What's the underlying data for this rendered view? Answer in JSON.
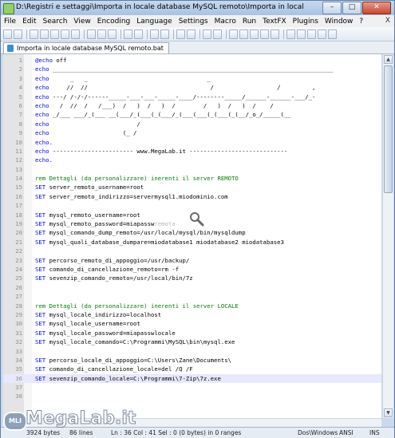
{
  "window": {
    "title": "D:\\Registri e settaggi\\Importa in locale database MySQL remoto\\Importa in locale database MySQL remoto.bat - Notepad++",
    "controls": [
      "minimize",
      "maximize",
      "close"
    ]
  },
  "menubar": {
    "items": [
      "File",
      "Edit",
      "Search",
      "View",
      "Encoding",
      "Language",
      "Settings",
      "Macro",
      "Run",
      "TextFX",
      "Plugins",
      "Window",
      "?"
    ],
    "close_glyph": "X"
  },
  "toolbar": {
    "icons": [
      "new-file-icon",
      "open-file-icon",
      "save-icon",
      "save-all-icon",
      "close-icon",
      "close-all-icon",
      "print-icon",
      "cut-icon",
      "copy-icon",
      "paste-icon",
      "undo-icon",
      "redo-icon",
      "find-icon",
      "replace-icon",
      "zoom-in-icon",
      "zoom-out-icon",
      "sync-v-icon",
      "sync-h-icon",
      "word-wrap-icon",
      "show-all-chars-icon",
      "indent-guide-icon",
      "user-lang-icon",
      "doc-map-icon",
      "record-macro-icon",
      "stop-record-icon",
      "playback-icon",
      "run-macro-multiple-icon",
      "save-macro-icon"
    ]
  },
  "tab": {
    "label": "Importa in locale database MySQL remoto.bat",
    "icon": "file-saved-icon"
  },
  "editor": {
    "current_line": 36,
    "lines": [
      {
        "n": "1",
        "segs": [
          {
            "t": "@echo off",
            "c": "kw-first"
          }
        ]
      },
      {
        "n": "2",
        "segs": [
          {
            "t": "echo ________________________________________________________________________________",
            "c": "kw-first"
          }
        ]
      },
      {
        "n": "3",
        "segs": [
          {
            "t": "echo      _   _                                  _",
            "c": "kw-first"
          }
        ]
      },
      {
        "n": "4",
        "segs": [
          {
            "t": "echo     //  //                                   /                  /         ,",
            "c": "kw-first"
          }
        ]
      },
      {
        "n": "5",
        "segs": [
          {
            "t": "echo ---/ /-/-/------_____-___-___-_____-____/--------_____/______-______-___/_-",
            "c": "kw-first"
          }
        ]
      },
      {
        "n": "6",
        "segs": [
          {
            "t": "echo   /  //  /   /___)  /   )  /   )  /        /   )  /   )  /    /",
            "c": "kw-first"
          }
        ]
      },
      {
        "n": "7",
        "segs": [
          {
            "t": "echo _/___ ___/_(___ __(___/_(___(_(___/_(___(___(_(___(_(__/_o_/_____(__",
            "c": "kw-first"
          }
        ]
      },
      {
        "n": "8",
        "segs": [
          {
            "t": "echo                         /",
            "c": "kw-first"
          }
        ]
      },
      {
        "n": "9",
        "segs": [
          {
            "t": "echo                     (_ /",
            "c": "kw-first"
          }
        ]
      },
      {
        "n": "10",
        "segs": [
          {
            "t": "echo.",
            "c": "kw-first"
          }
        ]
      },
      {
        "n": "11",
        "segs": [
          {
            "t": "echo ----------------------- www.MegaLab.it ----------------------------",
            "c": "kw-first"
          }
        ]
      },
      {
        "n": "12",
        "segs": [
          {
            "t": "echo.",
            "c": "kw-first"
          }
        ]
      },
      {
        "n": "13",
        "segs": [
          {
            "t": "",
            "c": ""
          }
        ]
      },
      {
        "n": "14",
        "segs": [
          {
            "t": "rem Dettagli (da personalizzare) inerenti il server REMOTO",
            "c": "rem"
          }
        ]
      },
      {
        "n": "15",
        "segs": [
          {
            "t": "SET server_remoto_username=root",
            "c": "kw-first"
          }
        ]
      },
      {
        "n": "16",
        "segs": [
          {
            "t": "SET server_remoto_indirizzo=servermysql1.miodominio.com",
            "c": "kw-first"
          }
        ]
      },
      {
        "n": "17",
        "segs": [
          {
            "t": "",
            "c": ""
          }
        ]
      },
      {
        "n": "18",
        "segs": [
          {
            "t": "SET mysql_remoto_username=root",
            "c": "kw-first"
          }
        ]
      },
      {
        "n": "19",
        "segs": [
          {
            "t": "SET mysql_remoto_password=miapassw",
            "c": "kw-first"
          },
          {
            "t": "remota",
            "c": "faded"
          }
        ]
      },
      {
        "n": "20",
        "segs": [
          {
            "t": "SET mysql_comando_dump_remoto=/usr/local/mysql/bin/mysqldump",
            "c": "kw-first"
          }
        ]
      },
      {
        "n": "21",
        "segs": [
          {
            "t": "SET mysql_quali_database_dumpare=miodatabase1 miodatabase2 miodatabase3",
            "c": "kw-first"
          }
        ]
      },
      {
        "n": "22",
        "segs": [
          {
            "t": "",
            "c": ""
          }
        ]
      },
      {
        "n": "23",
        "segs": [
          {
            "t": "SET percorso_remoto_di_appoggio=/usr/backup/",
            "c": "kw-first"
          }
        ]
      },
      {
        "n": "24",
        "segs": [
          {
            "t": "SET comando_di_cancellazione_remoto=rm -f",
            "c": "kw-first"
          }
        ]
      },
      {
        "n": "25",
        "segs": [
          {
            "t": "SET sevenzip_comando_remoto=/usr/local/bin/7z",
            "c": "kw-first"
          }
        ]
      },
      {
        "n": "26",
        "segs": [
          {
            "t": "",
            "c": ""
          }
        ]
      },
      {
        "n": "27",
        "segs": [
          {
            "t": "",
            "c": ""
          }
        ]
      },
      {
        "n": "28",
        "segs": [
          {
            "t": "rem Dettagli (da personalizzare) inerenti il server LOCALE",
            "c": "rem"
          }
        ]
      },
      {
        "n": "29",
        "segs": [
          {
            "t": "SET mysql_locale_indirizzo=localhost",
            "c": "kw-first"
          }
        ]
      },
      {
        "n": "30",
        "segs": [
          {
            "t": "SET mysql_locale_username=root",
            "c": "kw-first"
          }
        ]
      },
      {
        "n": "31",
        "segs": [
          {
            "t": "SET mysql_locale_password=miapasswlocale",
            "c": "kw-first"
          }
        ]
      },
      {
        "n": "32",
        "segs": [
          {
            "t": "SET mysql_locale_comando=C:\\Programmi\\MySQL\\bin\\mysql.exe",
            "c": "kw-first"
          }
        ]
      },
      {
        "n": "33",
        "segs": [
          {
            "t": "",
            "c": ""
          }
        ]
      },
      {
        "n": "34",
        "segs": [
          {
            "t": "SET percorso_locale_di_appoggio=C:\\Users\\Zane\\Documents\\",
            "c": "kw-first"
          }
        ]
      },
      {
        "n": "35",
        "segs": [
          {
            "t": "SET comando_di_cancellazione_locale=del /Q /F",
            "c": "kw-first"
          }
        ]
      },
      {
        "n": "36",
        "segs": [
          {
            "t": "SET sevenzip_comando_locale=C:\\Programmi\\7-Zip\\7z.exe",
            "c": "kw-first"
          }
        ]
      },
      {
        "n": "37",
        "segs": [
          {
            "t": "",
            "c": ""
          }
        ]
      },
      {
        "n": "38",
        "segs": [
          {
            "t": "",
            "c": ""
          }
        ]
      }
    ]
  },
  "statusbar": {
    "length": "3924 bytes",
    "lines": "86 lines",
    "position": "Ln : 36    Col : 41    Sel : 0 (0 bytes) in 0 ranges",
    "eol": "Dos\\Windows",
    "encoding": "ANSI",
    "mode": "INS"
  },
  "watermark": {
    "text": "MegaLab.it",
    "badge": "MLI"
  },
  "colors": {
    "keyword": "#0000ff",
    "comment": "#008000",
    "line_number": "#909090",
    "current_line_bg": "#e8e8ff"
  }
}
